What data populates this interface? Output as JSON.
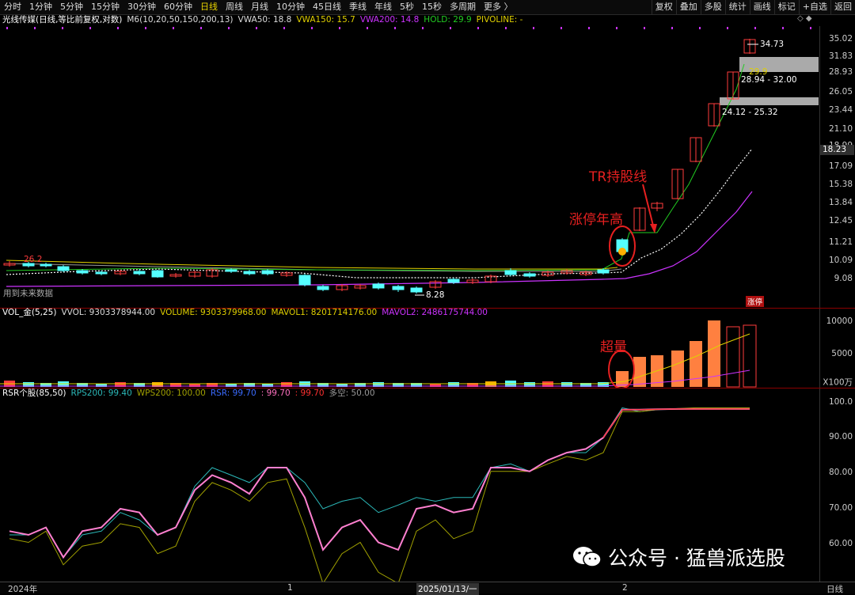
{
  "toolbar": {
    "tabs": [
      "分时",
      "1分钟",
      "5分钟",
      "15分钟",
      "30分钟",
      "60分钟",
      "日线",
      "周线",
      "月线",
      "10分钟",
      "45日线",
      "季线",
      "年线",
      "5秒",
      "15秒",
      "多周期",
      "更多 〉"
    ],
    "active_tab": "日线",
    "right_buttons": [
      "复权",
      "叠加",
      "多股",
      "统计",
      "画线",
      "标记",
      "+自选",
      "返回"
    ]
  },
  "main": {
    "title": "光线传媒(日线,等比前复权,对数)",
    "ma_label": "M6(10,20,50,150,200,13)",
    "vwa50": "VWA50: 18.8",
    "vwa150": "VWA150: 15.7",
    "vwa200": "VWA200: 14.8",
    "hold": "HOLD: 29.9",
    "pivot": "PIVOLINE: -",
    "note": "用到未来数据",
    "price_marks": {
      "high_label": "34.73",
      "low_label": "8.28",
      "left_label": "26.2",
      "hold_val": "29.9",
      "gap1": "28.94 - 32.00",
      "gap2": "24.12 - 25.32",
      "current_price": "18.23",
      "limit_tag": "涨停"
    },
    "y_labels": [
      "35.02",
      "31.83",
      "28.93",
      "26.05",
      "23.44",
      "21.10",
      "18.99",
      "17.09",
      "15.38",
      "13.84",
      "12.45",
      "11.21",
      "10.09",
      "9.08"
    ],
    "annotations": {
      "tr_line": "TR持股线",
      "limit_up_high": "涨停年高"
    },
    "colors": {
      "up": "#ff3d3d",
      "down": "#54ffff",
      "vwa50": "#dddddd",
      "vwa150": "#e0d000",
      "vwa200": "#cc33ff",
      "hold": "#22cc22"
    }
  },
  "volume": {
    "title": "VOL_金(5,25)",
    "vvol": "VVOL: 9303378944.00",
    "volume": "VOLUME: 9303379968.00",
    "mavol1": "MAVOL1: 8201714176.00",
    "mavol2": "MAVOL2: 2486175744.00",
    "y_labels": [
      "10000",
      "5000",
      "X100万"
    ],
    "annotation": "超量"
  },
  "rsr": {
    "title": "RSR个股(85,50)",
    "rps200": "RPS200: 99.40",
    "wps200": "WPS200: 100.00",
    "rsr": "RSR: 99.70",
    "v1": ": 99.70",
    "v2": ": 99.70",
    "duokong": "多空: 50.00",
    "y_labels": [
      "100.0",
      "90.00",
      "80.00",
      "70.00",
      "60.00"
    ]
  },
  "xaxis": {
    "labels": [
      "2024年",
      "1",
      "2025/01/13/一",
      "2",
      "日线"
    ]
  },
  "watermark": {
    "text": "公众号 · 猛兽派选股"
  },
  "chart_data": {
    "type": "line",
    "series": [
      {
        "name": "RPS200",
        "values": [
          66,
          66,
          68,
          60,
          66,
          67,
          72,
          70,
          66,
          68,
          79,
          84,
          82,
          80,
          84,
          84,
          80,
          73,
          75,
          76,
          72,
          74,
          76,
          75,
          76,
          76,
          84,
          85,
          83,
          86,
          88,
          88,
          92,
          100,
          99,
          99.5,
          99.6,
          99.7,
          99.7,
          99.6
        ]
      },
      {
        "name": "WPS200",
        "values": [
          65,
          64,
          67,
          58,
          63,
          64,
          69,
          68,
          61,
          63,
          75,
          80,
          78,
          75,
          80,
          81,
          68,
          53,
          61,
          64,
          56,
          53,
          67,
          70,
          65,
          67,
          83,
          83,
          83,
          85,
          87,
          86,
          88,
          99,
          99,
          99.5,
          99.8,
          100,
          100,
          100
        ]
      },
      {
        "name": "RSR",
        "values": [
          67,
          66,
          68,
          60,
          67,
          68,
          73,
          72,
          66,
          68,
          78,
          82,
          80,
          77,
          84,
          84,
          76,
          62,
          68,
          70,
          64,
          62,
          73,
          74,
          72,
          73,
          84,
          84,
          83,
          86,
          88,
          89,
          92,
          99.5,
          99.5,
          99.6,
          99.7,
          99.7,
          99.7,
          99.7
        ]
      }
    ]
  }
}
